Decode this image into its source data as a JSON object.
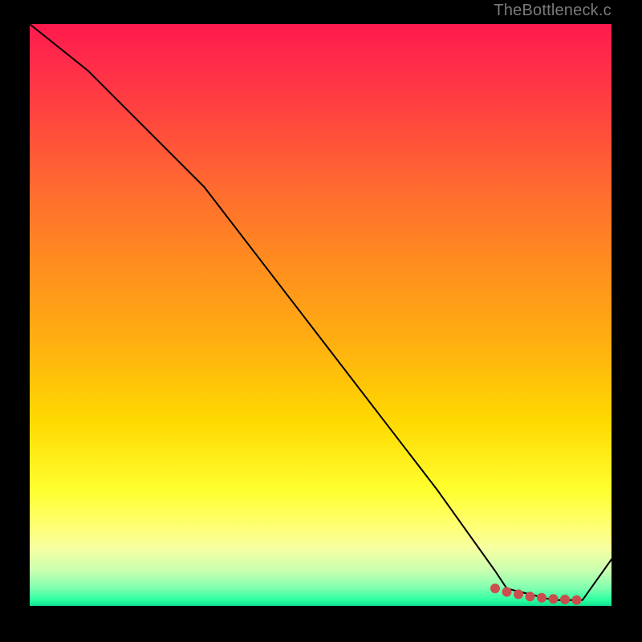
{
  "attribution": "TheBottleneck.com",
  "chart_data": {
    "type": "line",
    "title": "",
    "xlabel": "",
    "ylabel": "",
    "xlim": [
      0,
      100
    ],
    "ylim": [
      0,
      100
    ],
    "background_gradient_stops": [
      {
        "pos": 0,
        "color": "#ff1a4d"
      },
      {
        "pos": 14,
        "color": "#ff4040"
      },
      {
        "pos": 28,
        "color": "#ff6a30"
      },
      {
        "pos": 40,
        "color": "#ff8a20"
      },
      {
        "pos": 55,
        "color": "#ffb010"
      },
      {
        "pos": 68,
        "color": "#ffd800"
      },
      {
        "pos": 80,
        "color": "#ffff2e"
      },
      {
        "pos": 90,
        "color": "#f8ffa0"
      },
      {
        "pos": 97,
        "color": "#7effb0"
      },
      {
        "pos": 100,
        "color": "#10e090"
      }
    ],
    "series": [
      {
        "name": "main-curve",
        "color": "#000000",
        "x": [
          0,
          5,
          10,
          15,
          20,
          25,
          30,
          40,
          50,
          60,
          70,
          80,
          82,
          90,
          95,
          100
        ],
        "y": [
          100,
          96,
          92,
          87,
          82,
          77,
          72,
          59,
          46,
          33,
          20,
          6,
          3,
          1,
          1,
          8
        ]
      },
      {
        "name": "bottom-dots",
        "color": "#cc4d4d",
        "marker": "circle",
        "x": [
          80,
          82,
          84,
          86,
          88,
          90,
          92,
          94
        ],
        "y": [
          3.0,
          2.4,
          2.0,
          1.6,
          1.4,
          1.2,
          1.1,
          1.0
        ]
      }
    ]
  }
}
